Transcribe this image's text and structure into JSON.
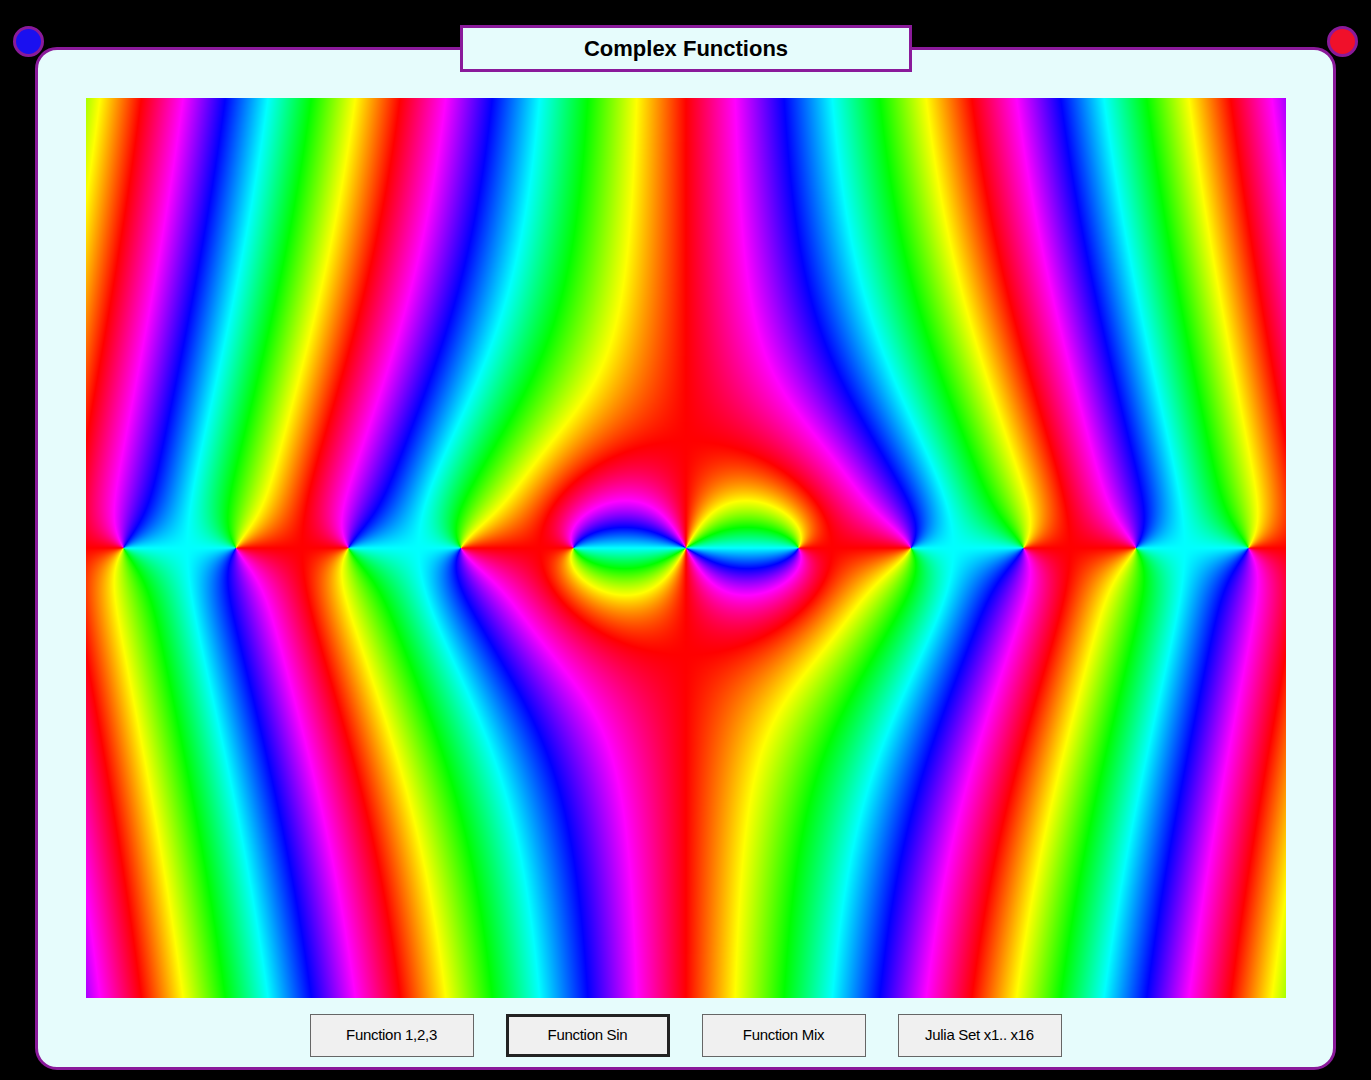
{
  "window": {
    "title": "Complex Functions"
  },
  "buttons": [
    {
      "label": "Function 1,2,3",
      "selected": false
    },
    {
      "label": "Function Sin",
      "selected": true
    },
    {
      "label": "Function Mix",
      "selected": false
    },
    {
      "label": "Julia Set x1.. x16",
      "selected": false
    }
  ]
}
